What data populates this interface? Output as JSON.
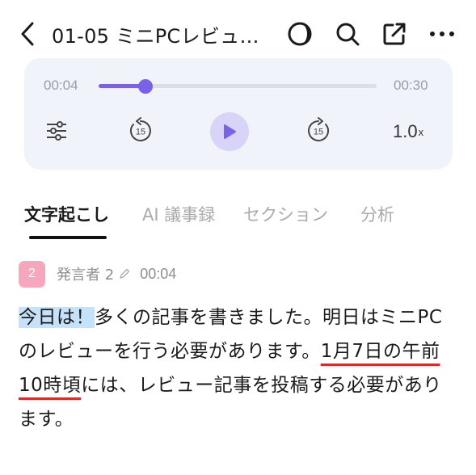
{
  "header": {
    "title": "01-05 ミニPCレビュ…",
    "icons": [
      "back-chevron-icon",
      "theme-icon",
      "search-icon",
      "share-icon",
      "more-icon"
    ]
  },
  "player": {
    "current_time": "00:04",
    "total_time": "00:30",
    "progress": 0.17,
    "speed": "1.0",
    "speed_suffix": "x",
    "rewind_seconds": "15",
    "forward_seconds": "15",
    "accent_color": "#7a62e8"
  },
  "tabs": [
    {
      "label": "文字起こし",
      "active": true
    },
    {
      "label": "AI 議事録",
      "active": false
    },
    {
      "label": "セクション",
      "active": false
    },
    {
      "label": "分析",
      "active": false
    }
  ],
  "segment": {
    "avatar": "2",
    "speaker": "発言者 2",
    "timestamp": "00:04",
    "text_parts": [
      {
        "text": "今日は！",
        "style": "highlight"
      },
      {
        "text": "多くの記事を書きました。明日はミニPCのレビューを行う必要があります。",
        "style": "plain"
      },
      {
        "text": "1月7日の午前10時頃",
        "style": "underline"
      },
      {
        "text": "には、レビュー記事を投稿する必要があります。",
        "style": "plain"
      }
    ]
  }
}
